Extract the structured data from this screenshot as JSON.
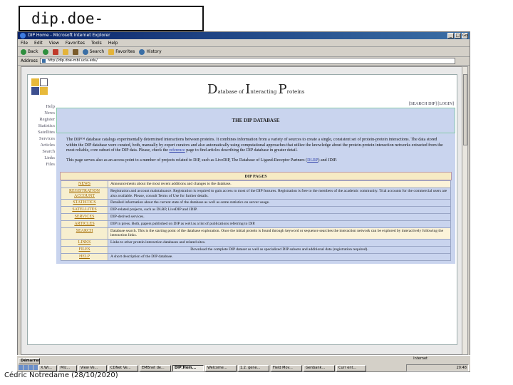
{
  "slide": {
    "title": "dip.doe-mbi.ucla.edu",
    "footer": "Cédric Notredame (28/10/2020)"
  },
  "browser": {
    "window_title": "DIP Home - Microsoft Internet Explorer",
    "menu": [
      "File",
      "Edit",
      "View",
      "Favorites",
      "Tools",
      "Help"
    ],
    "toolbar": {
      "back": "Back",
      "forward": "",
      "stop": "",
      "refresh": "",
      "home": "",
      "search": "Search",
      "favorites": "Favorites",
      "history": "History"
    },
    "address_label": "Address",
    "address": "http://dip.doe-mbi.ucla.edu/",
    "go": "Go"
  },
  "site": {
    "title_parts": [
      "D",
      "atabase of ",
      "I",
      "nteracting ",
      "P",
      "roteins"
    ],
    "header_links": "[SEARCH DIP] [LOGIN]",
    "sidenav": [
      "Help",
      "News",
      "Register",
      "Statistics",
      "Satellites",
      "Services",
      "Articles",
      "Search",
      "Links",
      "Files"
    ],
    "main_heading": "THE DIP DATABASE",
    "intro_1": "The DIP™ database catalogs experimentally determined interactions between proteins. It combines information from a variety of sources to create a single, consistent set of protein-protein interactions. The data stored within the DIP database were curated, both, manually by expert curators and also automatically using computational approaches that utilize the knowledge about the protein-protein interaction networks extracted from the most reliable, core subset of the DIP data. Please, check the",
    "intro_1_link": "reference",
    "intro_1_end": "page to find articles describing the DIP database in greater detail.",
    "intro_2": "This page serves also as an access point to a number of projects related to DIP, such as LiveDIP, The Database of Ligand-Receptor Partners (",
    "intro_2_link": "DLRP",
    "intro_2_end": ") and JDIP.",
    "pages_heading": "DIP PAGES",
    "pages": [
      {
        "name": "NEWS",
        "desc": "Announcements about the most recent additions and changes to the database."
      },
      {
        "name": "REGISTRATION ACCOUNT",
        "desc": "Registration and account maintainance. Registration is required to gain access to most of the DIP features. Registration is free to the members of the academic community. Trial accounts for the commercial users are also available. Please, consult Terms of Use for further details."
      },
      {
        "name": "STATISTICS",
        "desc": "Detailed information about the current state of the database as well as some statistics on server usage."
      },
      {
        "name": "SATELLITES",
        "desc": "DIP-related projects, such as DLRP, LiveDIP and JDIP."
      },
      {
        "name": "SERVICES",
        "desc": "DIP-derived services."
      },
      {
        "name": "ARTICLES",
        "desc": "DIP in press. Both, papers published on DIP as well as a list of publications referring to DIP."
      },
      {
        "name": "SEARCH",
        "desc": "Database search. This is the starting point of the database exploration. Once the initial protein is found through keyword or sequence searches the interaction network can be explored by interactively following the interaction links."
      },
      {
        "name": "LINKS",
        "desc": "Links to other protein interaction databases and related sites."
      },
      {
        "name": "FILES",
        "desc": "Download the complete DIP dataset as well as specialized DIP subsets and additional data (registration required)."
      },
      {
        "name": "HELP",
        "desc": "A short description of the DIP database."
      }
    ]
  },
  "taskbar": {
    "start": "Démarrer",
    "status_zone": "Internet",
    "tasks": [
      "X.Wi...",
      "Mic...",
      "View Ve...",
      "CDNet Ve...",
      "EMBnet de...",
      "DIP:Hom...",
      "Welcome...",
      "1.2. gene...",
      "Field Mov...",
      "Genbank...",
      "Curr ent..."
    ],
    "clock": "20:48"
  },
  "colors": {
    "page_blue": "#c9d4ee",
    "page_cream": "#f6ebc4",
    "link_orange": "#a36a00"
  }
}
